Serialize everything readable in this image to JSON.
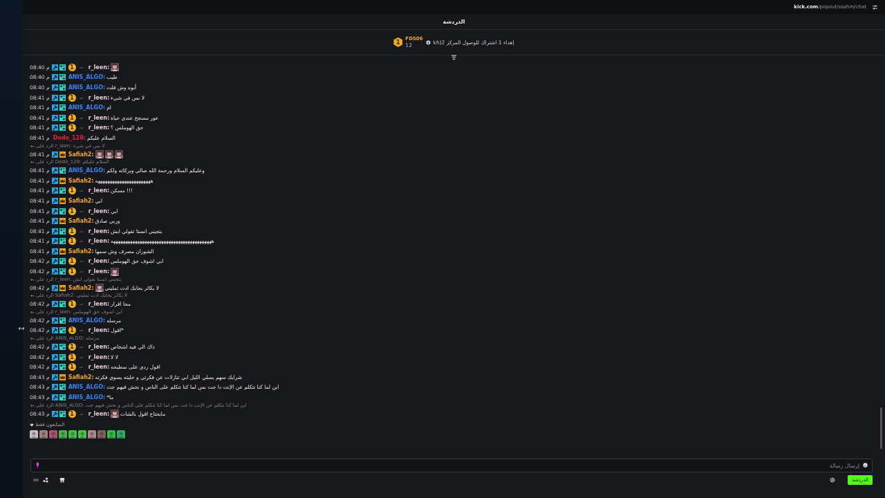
{
  "address_bar": {
    "host": "kick.com",
    "path": "/popout/ssahm/chat"
  },
  "chat_title": "الدردشة",
  "pinned": {
    "rank": "1",
    "user": "FD506",
    "count": "12",
    "text": "kh)إهداء 1 اشتراك للوصول المركز 2"
  },
  "messages": [
    {
      "time": "08:40 م",
      "badges": [
        {
          "kind": "mod"
        },
        {
          "kind": "og"
        },
        {
          "kind": "coin",
          "label": "1"
        },
        {
          "kind": "tag"
        }
      ],
      "user": "r_leen:",
      "color": "#e6cbd6",
      "emotes": [
        {
          "kind": "picture"
        }
      ]
    },
    {
      "time": "08:40 م",
      "badges": [
        {
          "kind": "mod"
        },
        {
          "kind": "og"
        }
      ],
      "user": "ANIS_ALGO:",
      "color": "#3b82f6",
      "text": "طيب"
    },
    {
      "time": "08:40 م",
      "badges": [
        {
          "kind": "mod"
        },
        {
          "kind": "og"
        }
      ],
      "user": "ANIS_ALGO:",
      "color": "#3b82f6",
      "text": "أيوه وش قلت"
    },
    {
      "time": "08:41 م",
      "badges": [
        {
          "kind": "mod"
        },
        {
          "kind": "og"
        },
        {
          "kind": "coin",
          "label": "1"
        },
        {
          "kind": "tag"
        }
      ],
      "user": "r_leen:",
      "color": "#e6cbd6",
      "text": "لا بس في شيء"
    },
    {
      "time": "08:41 م",
      "badges": [
        {
          "kind": "mod"
        },
        {
          "kind": "og"
        }
      ],
      "user": "ANIS_ALGO:",
      "color": "#3b82f6",
      "text": "ام"
    },
    {
      "time": "08:41 م",
      "badges": [
        {
          "kind": "mod"
        },
        {
          "kind": "og"
        },
        {
          "kind": "coin",
          "label": "1"
        },
        {
          "kind": "tag"
        }
      ],
      "user": "r_leen:",
      "color": "#e6cbd6",
      "text": "عور مسجح عندي حياة"
    },
    {
      "time": "08:41 م",
      "badges": [
        {
          "kind": "mod"
        },
        {
          "kind": "og"
        },
        {
          "kind": "coin",
          "label": "1"
        },
        {
          "kind": "tag"
        }
      ],
      "user": "r_leen:",
      "color": "#e6cbd6",
      "text": "حق الهوملس ؟"
    },
    {
      "time": "08:41 م",
      "user": "Dodo_128:",
      "color": "#e0263f",
      "text": "السلام عليكم"
    },
    {
      "reply": "الرد على r_leen: لا بس في شيء",
      "time": "08:41 م",
      "badges": [
        {
          "kind": "mod"
        },
        {
          "kind": "crown"
        }
      ],
      "user": "Safiah2:",
      "color": "#f5a623",
      "emotes": [
        {
          "kind": "picture"
        },
        {
          "kind": "picture"
        },
        {
          "kind": "picture"
        }
      ]
    },
    {
      "reply": "الرد على Dodo_128: السلام عليكم",
      "time": "08:41 م",
      "badges": [
        {
          "kind": "mod"
        },
        {
          "kind": "og"
        }
      ],
      "user": "ANIS_ALGO:",
      "color": "#3b82f6",
      "text": "وعليكم السلام ورحمة الله صالي وبركاته ولكم"
    },
    {
      "time": "08:41 م",
      "badges": [
        {
          "kind": "mod"
        },
        {
          "kind": "crown"
        }
      ],
      "user": "Safiah2:",
      "color": "#f5a623",
      "text": "هههههههههههههههههههههههه"
    },
    {
      "time": "08:41 م",
      "badges": [
        {
          "kind": "mod"
        },
        {
          "kind": "og"
        },
        {
          "kind": "coin",
          "label": "1"
        },
        {
          "kind": "tag"
        }
      ],
      "user": "r_leen:",
      "color": "#e6cbd6",
      "text": "مسكن !!!"
    },
    {
      "time": "08:41 م",
      "badges": [
        {
          "kind": "mod"
        },
        {
          "kind": "crown"
        }
      ],
      "user": "Safiah2:",
      "color": "#f5a623",
      "text": "ابي"
    },
    {
      "time": "08:41 م",
      "badges": [
        {
          "kind": "mod"
        },
        {
          "kind": "og"
        },
        {
          "kind": "coin",
          "label": "1"
        },
        {
          "kind": "tag"
        }
      ],
      "user": "r_leen:",
      "color": "#e6cbd6",
      "text": "ابي"
    },
    {
      "time": "08:41 م",
      "badges": [
        {
          "kind": "mod"
        },
        {
          "kind": "crown"
        }
      ],
      "user": "Safiah2:",
      "color": "#f5a623",
      "text": "وربي صادق"
    },
    {
      "time": "08:41 م",
      "badges": [
        {
          "kind": "mod"
        },
        {
          "kind": "og"
        },
        {
          "kind": "coin",
          "label": "1"
        },
        {
          "kind": "tag"
        }
      ],
      "user": "r_leen:",
      "color": "#e6cbd6",
      "text": "يتجيني انستا تقولي ايش"
    },
    {
      "time": "08:41 م",
      "badges": [
        {
          "kind": "mod"
        },
        {
          "kind": "og"
        },
        {
          "kind": "coin",
          "label": "1"
        },
        {
          "kind": "tag"
        }
      ],
      "user": "r_leen:",
      "color": "#e6cbd6",
      "text": "ههههههههههههههههههههههههههههههههههههههههههه"
    },
    {
      "time": "08:41 م",
      "badges": [
        {
          "kind": "mod"
        },
        {
          "kind": "crown"
        }
      ],
      "user": "Safiah2:",
      "color": "#f5a623",
      "text": "الشوران مصرف وش سمها"
    },
    {
      "time": "08:42 م",
      "badges": [
        {
          "kind": "mod"
        },
        {
          "kind": "og"
        },
        {
          "kind": "coin",
          "label": "1"
        },
        {
          "kind": "tag"
        }
      ],
      "user": "r_leen:",
      "color": "#e6cbd6",
      "text": "ابي اشوف حق الهوملس"
    },
    {
      "time": "08:42 م",
      "badges": [
        {
          "kind": "mod"
        },
        {
          "kind": "og"
        },
        {
          "kind": "coin",
          "label": "1"
        },
        {
          "kind": "tag"
        }
      ],
      "user": "r_leen:",
      "color": "#e6cbd6",
      "emotes": [
        {
          "kind": "picture"
        }
      ]
    },
    {
      "reply": "الرد على r_leen: يتجيني انستا تقولي ايش",
      "time": "08:42 م",
      "badges": [
        {
          "kind": "mod"
        },
        {
          "kind": "crown"
        }
      ],
      "user": "Safiah2:",
      "color": "#f5a623",
      "text": "لا يكاثر يحايك ادت تمليني",
      "emotes": [
        {
          "kind": "picture"
        }
      ]
    },
    {
      "reply": "الرد على Safiah2: لا يكاثر يحايك ادت تمليني",
      "time": "08:42 م",
      "badges": [
        {
          "kind": "mod"
        },
        {
          "kind": "og"
        },
        {
          "kind": "coin",
          "label": "1"
        },
        {
          "kind": "tag"
        }
      ],
      "user": "r_leen:",
      "color": "#e6cbd6",
      "text": "محا اقرار"
    },
    {
      "reply": "الرد على r_leen: ابي اشوف حق الهوملس",
      "time": "08:42 م",
      "badges": [
        {
          "kind": "mod"
        },
        {
          "kind": "og"
        }
      ],
      "user": "ANIS_ALGO:",
      "color": "#3b82f6",
      "text": "مرسله"
    },
    {
      "time": "08:42 م",
      "badges": [
        {
          "kind": "mod"
        },
        {
          "kind": "og"
        },
        {
          "kind": "coin",
          "label": "1"
        },
        {
          "kind": "tag"
        }
      ],
      "user": "r_leen:",
      "color": "#e6cbd6",
      "text": "اقول*"
    },
    {
      "reply": "الرد على ANIS_ALGO: مرسله",
      "time": "08:42 م",
      "badges": [
        {
          "kind": "mod"
        },
        {
          "kind": "og"
        },
        {
          "kind": "coin",
          "label": "1"
        },
        {
          "kind": "tag"
        }
      ],
      "user": "r_leen:",
      "color": "#e6cbd6",
      "text": "ذاك الي فيه اشخاص"
    },
    {
      "time": "08:42 م",
      "badges": [
        {
          "kind": "mod"
        },
        {
          "kind": "og"
        },
        {
          "kind": "coin",
          "label": "1"
        },
        {
          "kind": "tag"
        }
      ],
      "user": "r_leen:",
      "color": "#e6cbd6",
      "text": "لا لا"
    },
    {
      "time": "08:42 م",
      "badges": [
        {
          "kind": "mod"
        },
        {
          "kind": "og"
        },
        {
          "kind": "coin",
          "label": "1"
        },
        {
          "kind": "tag"
        }
      ],
      "user": "r_leen:",
      "color": "#e6cbd6",
      "text": "اقول ردي على سطيحه"
    },
    {
      "time": "08:43 م",
      "badges": [
        {
          "kind": "mod"
        },
        {
          "kind": "crown"
        }
      ],
      "user": "Safiah2:",
      "color": "#f5a623",
      "text": "شرايك سهم يسلي الليل ابي تنازلات عن فكرتي و خليته يسوي فكرته"
    },
    {
      "time": "08:43 م",
      "badges": [
        {
          "kind": "mod"
        },
        {
          "kind": "og"
        }
      ],
      "user": "ANIS_ALGO:",
      "color": "#3b82f6",
      "text": "اين لما كنا نتكلم عن الإنت دا جت بس لما كنا نتكلم على الناس و نحش فيهم جت"
    },
    {
      "time": "08:43 م",
      "badges": [
        {
          "kind": "mod"
        },
        {
          "kind": "og"
        }
      ],
      "user": "ANIS_ALGO:",
      "color": "#3b82f6",
      "text": "*ما"
    },
    {
      "reply": "الرد على ANIS_ALGO: اين لما كنا نتكلم عن الإنت دا جت بس لما كنا نتكلم على الناس و نحش فيهم جت",
      "time": "08:43 م",
      "badges": [
        {
          "kind": "mod"
        },
        {
          "kind": "og"
        },
        {
          "kind": "coin",
          "label": "1"
        },
        {
          "kind": "tag"
        }
      ],
      "user": "r_leen:",
      "color": "#e6cbd6",
      "emotes": [
        {
          "kind": "picture"
        }
      ],
      "text": "مايحتاج اقول بالشات"
    }
  ],
  "followers_only": {
    "label": "المتابعون فقط"
  },
  "viewer_avatars": [
    {
      "color": "#c8c0c0"
    },
    {
      "color": "#a08080"
    },
    {
      "color": "#b05070"
    },
    {
      "color": "#4caf50"
    },
    {
      "color": "#43c04a"
    },
    {
      "color": "#49c24a"
    },
    {
      "color": "#b08890"
    },
    {
      "color": "#806060"
    },
    {
      "color": "#2fbf3f"
    },
    {
      "color": "#3aa860"
    }
  ],
  "composer": {
    "placeholder": "إرسال رسالة"
  },
  "chat_button": "الدردشة"
}
